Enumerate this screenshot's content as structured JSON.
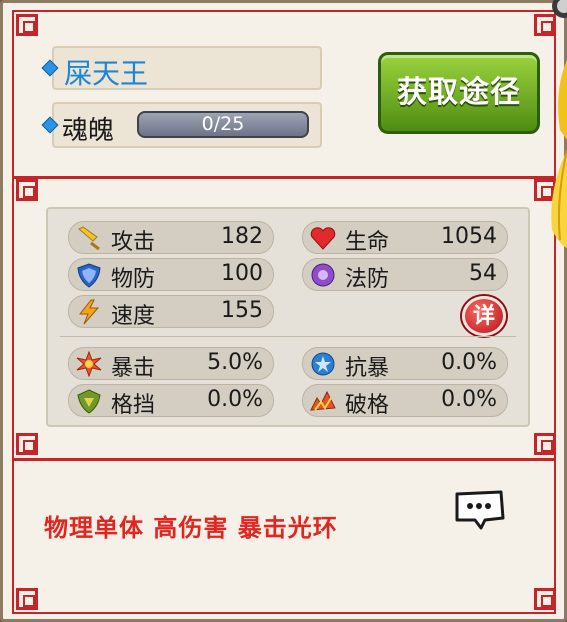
{
  "hero": {
    "name": "屎天王",
    "soul_label": "魂魄",
    "soul_progress": "0/25",
    "soul_fraction": 0.0
  },
  "acquire_button": {
    "label": "获取途径"
  },
  "stats": {
    "attack": {
      "label": "攻击",
      "value": "182",
      "icon": "sword-icon"
    },
    "hp": {
      "label": "生命",
      "value": "1054",
      "icon": "heart-icon"
    },
    "phys_def": {
      "label": "物防",
      "value": "100",
      "icon": "shield-icon"
    },
    "magic_def": {
      "label": "法防",
      "value": "54",
      "icon": "magic-orb-icon"
    },
    "speed": {
      "label": "速度",
      "value": "155",
      "icon": "lightning-icon"
    },
    "crit": {
      "label": "暴击",
      "value": "5.0%",
      "icon": "burst-icon"
    },
    "crit_resist": {
      "label": "抗暴",
      "value": "0.0%",
      "icon": "star-shield-icon"
    },
    "block": {
      "label": "格挡",
      "value": "0.0%",
      "icon": "guard-icon"
    },
    "block_break": {
      "label": "破格",
      "value": "0.0%",
      "icon": "break-icon"
    }
  },
  "detail_button": {
    "label": "详"
  },
  "description": "物理单体 高伤害 暴击光环",
  "colors": {
    "accent_red": "#c7242a",
    "name_blue": "#1b86d6",
    "button_green": "#5fa31a",
    "desc_red": "#e1251f"
  }
}
